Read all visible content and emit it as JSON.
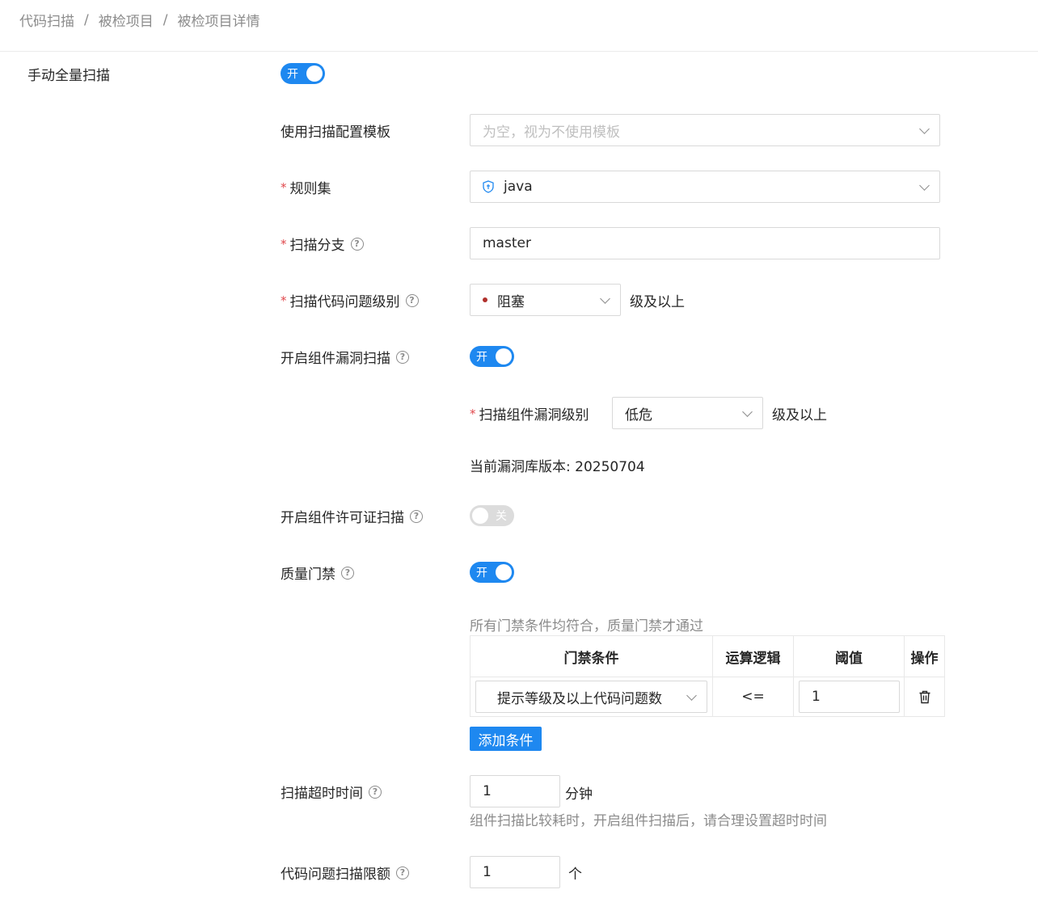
{
  "breadcrumb": [
    "代码扫描",
    "被检项目",
    "被检项目详情"
  ],
  "full_scan": {
    "label": "手动全量扫描",
    "switch_text": "开"
  },
  "template": {
    "label": "使用扫描配置模板",
    "placeholder": "为空，视为不使用模板"
  },
  "ruleset": {
    "label": "规则集",
    "value": "java"
  },
  "branch": {
    "label": "扫描分支",
    "value": "master"
  },
  "issue_level": {
    "label": "扫描代码问题级别",
    "value": "阻塞",
    "suffix": "级及以上",
    "dot_color": "#b0302c"
  },
  "component_vuln": {
    "label": "开启组件漏洞扫描",
    "switch_text": "开",
    "level_label": "扫描组件漏洞级别",
    "level_value": "低危",
    "level_suffix": "级及以上",
    "db_version": "当前漏洞库版本: 20250704"
  },
  "license_scan": {
    "label": "开启组件许可证扫描",
    "switch_text": "关"
  },
  "quality_gate": {
    "label": "质量门禁",
    "switch_text": "开",
    "note": "所有门禁条件均符合，质量门禁才通过",
    "columns": [
      "门禁条件",
      "运算逻辑",
      "阈值",
      "操作"
    ],
    "rows": [
      {
        "condition": "提示等级及以上代码问题数",
        "operator": "<=",
        "threshold": "1"
      }
    ],
    "add_button": "添加条件"
  },
  "timeout": {
    "label": "扫描超时时间",
    "value": "1",
    "unit": "分钟",
    "hint": "组件扫描比较耗时，开启组件扫描后，请合理设置超时时间"
  },
  "issue_limit": {
    "label": "代码问题扫描限额",
    "value": "1",
    "unit": "个"
  },
  "colors": {
    "accent": "#1e88f0",
    "required": "#e0474b"
  }
}
